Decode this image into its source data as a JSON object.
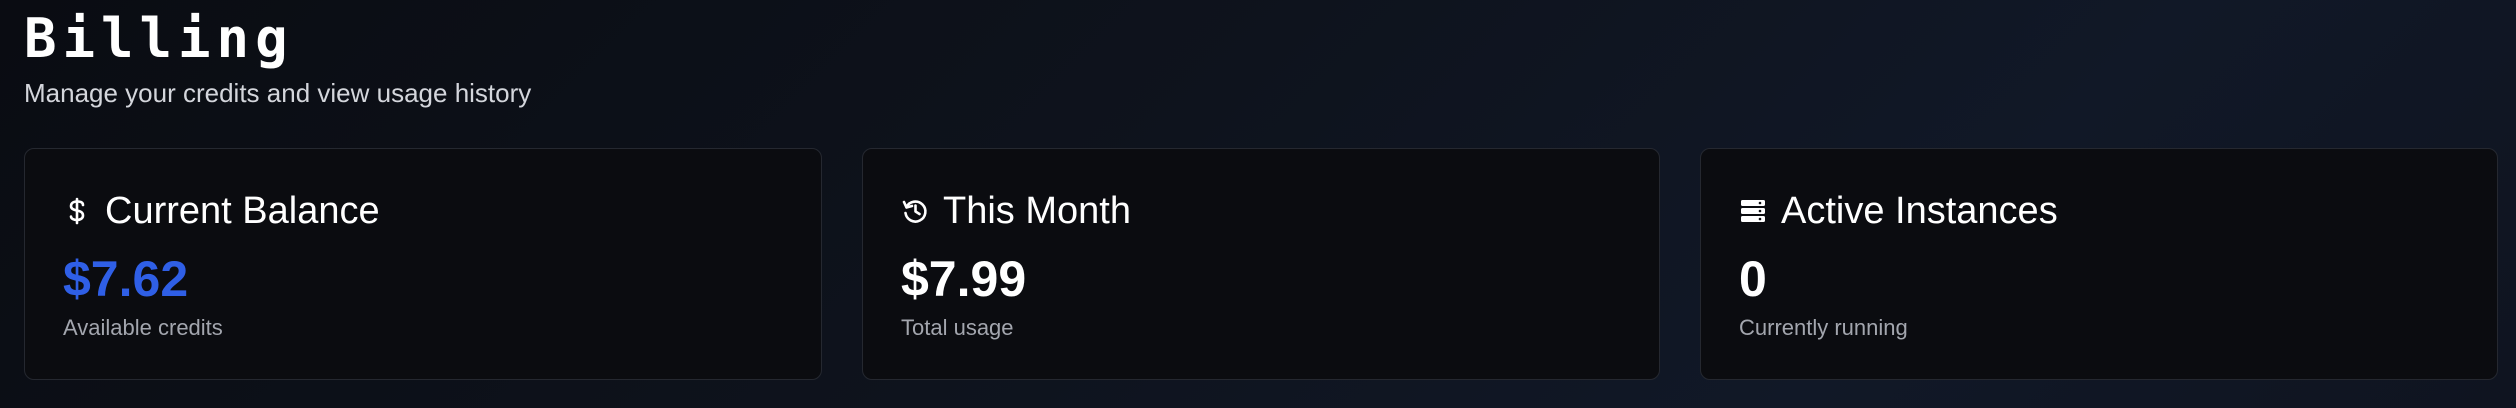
{
  "header": {
    "title": "Billing",
    "subtitle": "Manage your credits and view usage history"
  },
  "cards": [
    {
      "icon": "dollar-icon",
      "title": "Current Balance",
      "value": "$7.62",
      "note": "Available credits",
      "value_color": "#2f5fe6"
    },
    {
      "icon": "history-icon",
      "title": "This Month",
      "value": "$7.99",
      "note": "Total usage",
      "value_color": "#ffffff"
    },
    {
      "icon": "server-icon",
      "title": "Active Instances",
      "value": "0",
      "note": "Currently running",
      "value_color": "#ffffff"
    }
  ]
}
